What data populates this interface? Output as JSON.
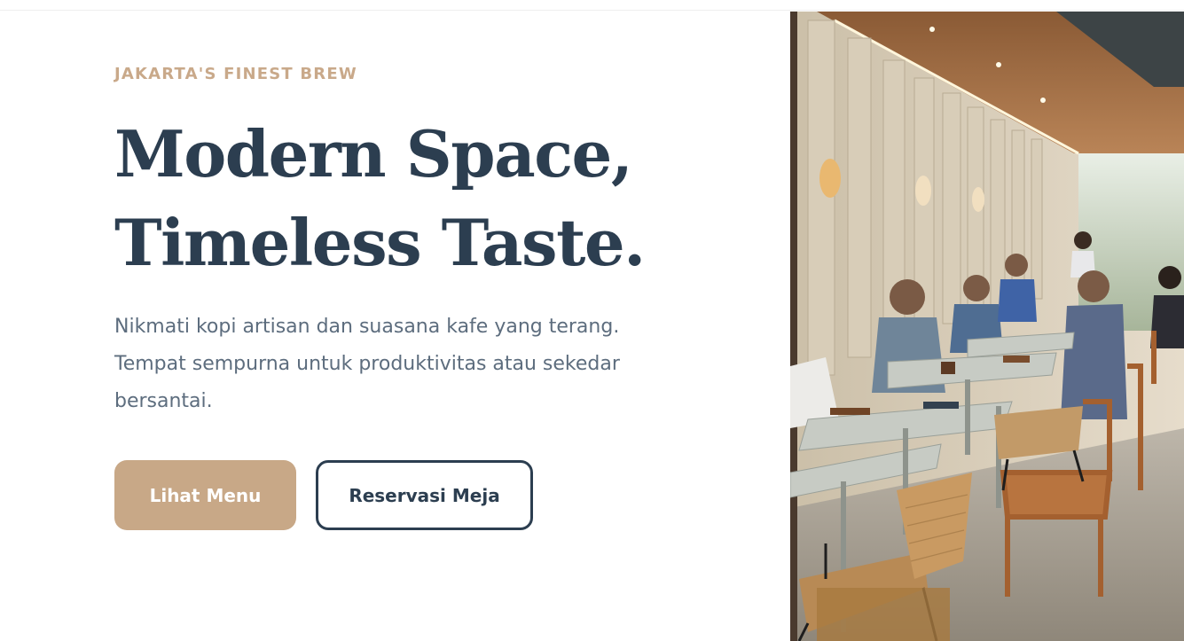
{
  "hero": {
    "eyebrow": "JAKARTA'S FINEST BREW",
    "title_line1": "Modern Space,",
    "title_line2": "Timeless Taste.",
    "description": "Nikmati kopi artisan dan suasana kafe yang terang. Tempat sempurna untuk produktivitas atau sekedar bersantai.",
    "primary_button": "Lihat Menu",
    "secondary_button": "Reservasi Meja"
  },
  "colors": {
    "accent": "#c8a887",
    "eyebrow": "#c9a98a",
    "heading": "#2c3e50",
    "body_text": "#5d6d7e",
    "background": "#ffffff"
  },
  "image": {
    "subject": "cafe-interior-photo"
  }
}
